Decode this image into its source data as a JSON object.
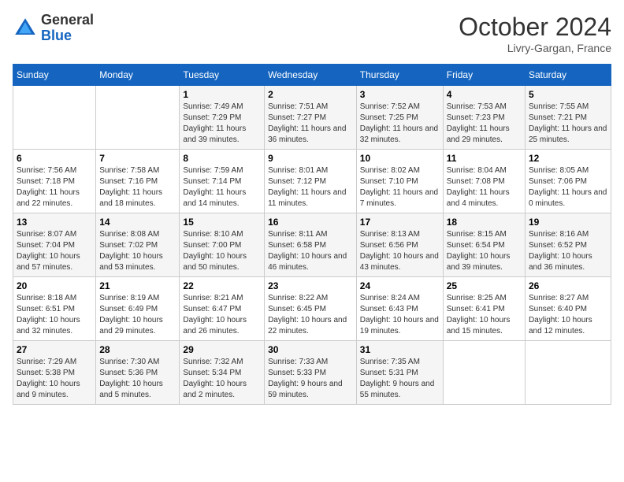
{
  "header": {
    "logo_general": "General",
    "logo_blue": "Blue",
    "month_title": "October 2024",
    "location": "Livry-Gargan, France"
  },
  "weekdays": [
    "Sunday",
    "Monday",
    "Tuesday",
    "Wednesday",
    "Thursday",
    "Friday",
    "Saturday"
  ],
  "weeks": [
    [
      {
        "day": "",
        "detail": ""
      },
      {
        "day": "",
        "detail": ""
      },
      {
        "day": "1",
        "detail": "Sunrise: 7:49 AM\nSunset: 7:29 PM\nDaylight: 11 hours and 39 minutes."
      },
      {
        "day": "2",
        "detail": "Sunrise: 7:51 AM\nSunset: 7:27 PM\nDaylight: 11 hours and 36 minutes."
      },
      {
        "day": "3",
        "detail": "Sunrise: 7:52 AM\nSunset: 7:25 PM\nDaylight: 11 hours and 32 minutes."
      },
      {
        "day": "4",
        "detail": "Sunrise: 7:53 AM\nSunset: 7:23 PM\nDaylight: 11 hours and 29 minutes."
      },
      {
        "day": "5",
        "detail": "Sunrise: 7:55 AM\nSunset: 7:21 PM\nDaylight: 11 hours and 25 minutes."
      }
    ],
    [
      {
        "day": "6",
        "detail": "Sunrise: 7:56 AM\nSunset: 7:18 PM\nDaylight: 11 hours and 22 minutes."
      },
      {
        "day": "7",
        "detail": "Sunrise: 7:58 AM\nSunset: 7:16 PM\nDaylight: 11 hours and 18 minutes."
      },
      {
        "day": "8",
        "detail": "Sunrise: 7:59 AM\nSunset: 7:14 PM\nDaylight: 11 hours and 14 minutes."
      },
      {
        "day": "9",
        "detail": "Sunrise: 8:01 AM\nSunset: 7:12 PM\nDaylight: 11 hours and 11 minutes."
      },
      {
        "day": "10",
        "detail": "Sunrise: 8:02 AM\nSunset: 7:10 PM\nDaylight: 11 hours and 7 minutes."
      },
      {
        "day": "11",
        "detail": "Sunrise: 8:04 AM\nSunset: 7:08 PM\nDaylight: 11 hours and 4 minutes."
      },
      {
        "day": "12",
        "detail": "Sunrise: 8:05 AM\nSunset: 7:06 PM\nDaylight: 11 hours and 0 minutes."
      }
    ],
    [
      {
        "day": "13",
        "detail": "Sunrise: 8:07 AM\nSunset: 7:04 PM\nDaylight: 10 hours and 57 minutes."
      },
      {
        "day": "14",
        "detail": "Sunrise: 8:08 AM\nSunset: 7:02 PM\nDaylight: 10 hours and 53 minutes."
      },
      {
        "day": "15",
        "detail": "Sunrise: 8:10 AM\nSunset: 7:00 PM\nDaylight: 10 hours and 50 minutes."
      },
      {
        "day": "16",
        "detail": "Sunrise: 8:11 AM\nSunset: 6:58 PM\nDaylight: 10 hours and 46 minutes."
      },
      {
        "day": "17",
        "detail": "Sunrise: 8:13 AM\nSunset: 6:56 PM\nDaylight: 10 hours and 43 minutes."
      },
      {
        "day": "18",
        "detail": "Sunrise: 8:15 AM\nSunset: 6:54 PM\nDaylight: 10 hours and 39 minutes."
      },
      {
        "day": "19",
        "detail": "Sunrise: 8:16 AM\nSunset: 6:52 PM\nDaylight: 10 hours and 36 minutes."
      }
    ],
    [
      {
        "day": "20",
        "detail": "Sunrise: 8:18 AM\nSunset: 6:51 PM\nDaylight: 10 hours and 32 minutes."
      },
      {
        "day": "21",
        "detail": "Sunrise: 8:19 AM\nSunset: 6:49 PM\nDaylight: 10 hours and 29 minutes."
      },
      {
        "day": "22",
        "detail": "Sunrise: 8:21 AM\nSunset: 6:47 PM\nDaylight: 10 hours and 26 minutes."
      },
      {
        "day": "23",
        "detail": "Sunrise: 8:22 AM\nSunset: 6:45 PM\nDaylight: 10 hours and 22 minutes."
      },
      {
        "day": "24",
        "detail": "Sunrise: 8:24 AM\nSunset: 6:43 PM\nDaylight: 10 hours and 19 minutes."
      },
      {
        "day": "25",
        "detail": "Sunrise: 8:25 AM\nSunset: 6:41 PM\nDaylight: 10 hours and 15 minutes."
      },
      {
        "day": "26",
        "detail": "Sunrise: 8:27 AM\nSunset: 6:40 PM\nDaylight: 10 hours and 12 minutes."
      }
    ],
    [
      {
        "day": "27",
        "detail": "Sunrise: 7:29 AM\nSunset: 5:38 PM\nDaylight: 10 hours and 9 minutes."
      },
      {
        "day": "28",
        "detail": "Sunrise: 7:30 AM\nSunset: 5:36 PM\nDaylight: 10 hours and 5 minutes."
      },
      {
        "day": "29",
        "detail": "Sunrise: 7:32 AM\nSunset: 5:34 PM\nDaylight: 10 hours and 2 minutes."
      },
      {
        "day": "30",
        "detail": "Sunrise: 7:33 AM\nSunset: 5:33 PM\nDaylight: 9 hours and 59 minutes."
      },
      {
        "day": "31",
        "detail": "Sunrise: 7:35 AM\nSunset: 5:31 PM\nDaylight: 9 hours and 55 minutes."
      },
      {
        "day": "",
        "detail": ""
      },
      {
        "day": "",
        "detail": ""
      }
    ]
  ]
}
